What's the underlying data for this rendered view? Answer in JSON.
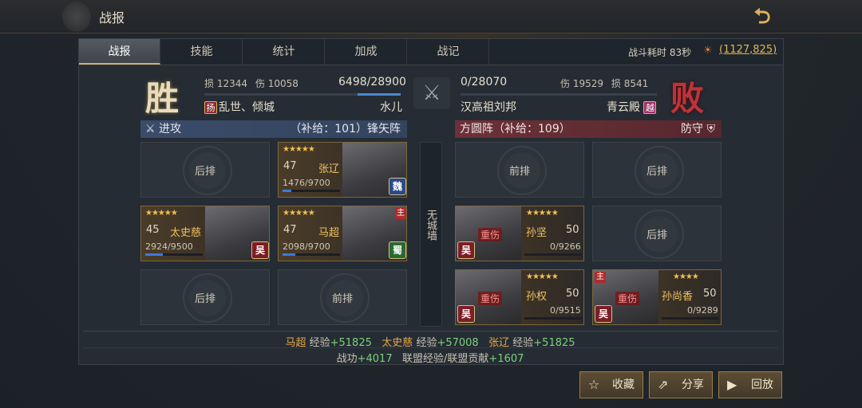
{
  "header": {
    "title": "战报"
  },
  "tabs": [
    {
      "label": "战报"
    },
    {
      "label": "技能"
    },
    {
      "label": "统计"
    },
    {
      "label": "加成"
    },
    {
      "label": "战记"
    }
  ],
  "battle": {
    "duration": "战斗耗时 83秒",
    "coords": "(1127,825)"
  },
  "left": {
    "result": "胜",
    "loss_label": "损",
    "loss": "12344",
    "dmg_label": "伤",
    "dmg": "10058",
    "troops": "6498/28900",
    "troops_fraction": 0.22,
    "alliance_badge": "扬",
    "alliance": "乱世、倾城",
    "player": "水儿",
    "header_left": "进攻",
    "header_right": "（补给：101）锋矢阵"
  },
  "right": {
    "result": "败",
    "troops": "0/28070",
    "dmg_label": "伤",
    "dmg": "19529",
    "loss_label": "损",
    "loss": "8541",
    "player": "汉高祖刘邦",
    "city": "青云殿",
    "city_badge": "越",
    "header_left": "方圆阵（补给：109）",
    "header_right": "防守"
  },
  "slots": {
    "back": "后排",
    "front": "前排"
  },
  "wall": "无城墙",
  "heroes": {
    "zhangliao": {
      "level": "47",
      "name": "张辽",
      "hp": "1476/9700",
      "hp_fraction": 0.15,
      "faction": "魏",
      "stars": "★★★★★"
    },
    "taishici": {
      "level": "45",
      "name": "太史慈",
      "hp": "2924/9500",
      "hp_fraction": 0.31,
      "faction": "吴",
      "stars": "★★★★★"
    },
    "machao": {
      "level": "47",
      "name": "马超",
      "hp": "2098/9700",
      "hp_fraction": 0.22,
      "faction": "蜀",
      "stars": "★★★★★",
      "tag": "主"
    },
    "sunjian": {
      "level": "50",
      "name": "孙坚",
      "hp": "0/9266",
      "faction": "吴",
      "stars": "★★★★★",
      "status": "重伤"
    },
    "sunquan": {
      "level": "50",
      "name": "孙权",
      "hp": "0/9515",
      "faction": "吴",
      "stars": "★★★★★",
      "status": "重伤"
    },
    "sunshangxiang": {
      "level": "50",
      "name": "孙尚香",
      "hp": "0/9289",
      "faction": "吴",
      "stars": "★★★★",
      "status": "重伤",
      "tag": "主"
    }
  },
  "rewards": {
    "exp_label": "经验",
    "h1": "马超",
    "e1": "+51825",
    "h2": "太史慈",
    "e2": "+57008",
    "h3": "张辽",
    "e3": "+51825",
    "merit_label": "战功",
    "merit": "+4017",
    "alliance_label": "联盟经验/联盟贡献",
    "alliance": "+1607"
  },
  "buttons": {
    "collect": "收藏",
    "share": "分享",
    "replay": "回放"
  }
}
